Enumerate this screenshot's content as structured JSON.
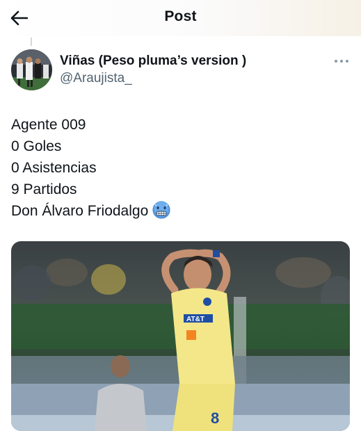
{
  "header": {
    "title": "Post",
    "back_icon": "arrow-left-icon"
  },
  "author": {
    "display_name": "Viñas (Peso pluma’s version )",
    "handle": "@Araujista_",
    "more_icon": "more-dots-icon"
  },
  "tweet": {
    "lines": [
      "Agente 009",
      "0 Goles",
      "0 Asistencias",
      "9 Partidos",
      "Don Álvaro Friodalgo"
    ],
    "emoji": "cold-face-emoji"
  },
  "media": {
    "type": "photo",
    "jersey_sponsor": "AT&T",
    "jersey_number": "8"
  },
  "colors": {
    "text": "#0f1419",
    "secondary_text": "#536471",
    "jersey_yellow": "#f3e78a",
    "emoji_blue": "#5aa0e8"
  }
}
